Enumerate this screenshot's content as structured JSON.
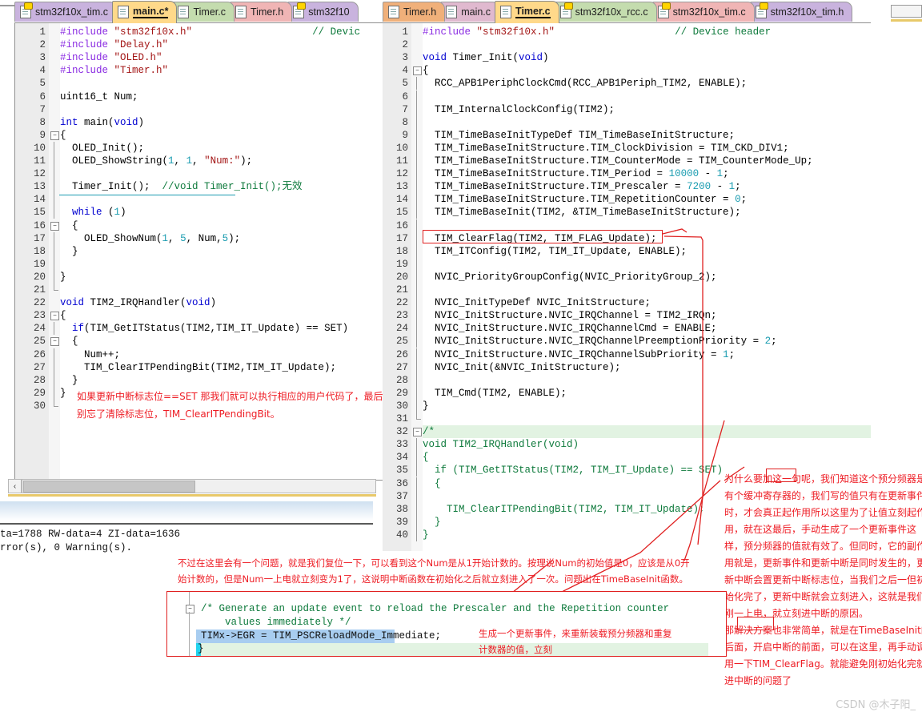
{
  "app": {
    "watermark": "CSDN @木子阳_"
  },
  "left_pane": {
    "tabs": [
      {
        "label": "stm32f10x_tim.c",
        "color": "#c9b3de",
        "active": false,
        "icon": "file-key-icon"
      },
      {
        "label": "main.c*",
        "color": "#ffd98a",
        "active": true,
        "icon": "file-icon"
      },
      {
        "label": "Timer.c",
        "color": "#c4dcae",
        "active": false,
        "icon": "file-icon"
      },
      {
        "label": "Timer.h",
        "color": "#f0b5b5",
        "active": false,
        "icon": "file-icon"
      },
      {
        "label": "stm32f10",
        "color": "#c9b3de",
        "active": false,
        "icon": "file-key-icon"
      }
    ],
    "lines": [
      {
        "n": 1,
        "fold": "",
        "tokens": [
          {
            "t": "#include ",
            "c": "pp"
          },
          {
            "t": "\"stm32f10x.h\"",
            "c": "str"
          },
          {
            "t": "                    ",
            "c": "pl"
          },
          {
            "t": "// Devic",
            "c": "cmt"
          }
        ]
      },
      {
        "n": 2,
        "fold": "",
        "tokens": [
          {
            "t": "#include ",
            "c": "pp"
          },
          {
            "t": "\"Delay.h\"",
            "c": "str"
          }
        ]
      },
      {
        "n": 3,
        "fold": "",
        "tokens": [
          {
            "t": "#include ",
            "c": "pp"
          },
          {
            "t": "\"OLED.h\"",
            "c": "str"
          }
        ]
      },
      {
        "n": 4,
        "fold": "",
        "tokens": [
          {
            "t": "#include ",
            "c": "pp"
          },
          {
            "t": "\"Timer.h\"",
            "c": "str"
          }
        ]
      },
      {
        "n": 5,
        "fold": "",
        "tokens": []
      },
      {
        "n": 6,
        "fold": "",
        "tokens": [
          {
            "t": "uint16_t Num;",
            "c": "pl"
          }
        ]
      },
      {
        "n": 7,
        "fold": "",
        "tokens": []
      },
      {
        "n": 8,
        "fold": "",
        "tokens": [
          {
            "t": "int",
            "c": "kw"
          },
          {
            "t": " main(",
            "c": "pl"
          },
          {
            "t": "void",
            "c": "kw"
          },
          {
            "t": ")",
            "c": "pl"
          }
        ]
      },
      {
        "n": 9,
        "fold": "-",
        "tokens": [
          {
            "t": "{",
            "c": "pl"
          }
        ]
      },
      {
        "n": 10,
        "fold": "|",
        "tokens": [
          {
            "t": "  OLED_Init();",
            "c": "pl"
          }
        ]
      },
      {
        "n": 11,
        "fold": "|",
        "tokens": [
          {
            "t": "  OLED_ShowString(",
            "c": "pl"
          },
          {
            "t": "1",
            "c": "num"
          },
          {
            "t": ", ",
            "c": "pl"
          },
          {
            "t": "1",
            "c": "num"
          },
          {
            "t": ", ",
            "c": "pl"
          },
          {
            "t": "\"Num:\"",
            "c": "str"
          },
          {
            "t": ");",
            "c": "pl"
          }
        ]
      },
      {
        "n": 12,
        "fold": "|",
        "tokens": []
      },
      {
        "n": 13,
        "fold": "|",
        "tokens": [
          {
            "t": "  Timer_Init();  ",
            "c": "pl"
          },
          {
            "t": "//void Timer_Init();无效",
            "c": "cmt"
          }
        ],
        "underline": true
      },
      {
        "n": 14,
        "fold": "|",
        "tokens": []
      },
      {
        "n": 15,
        "fold": "|",
        "tokens": [
          {
            "t": "  ",
            "c": "pl"
          },
          {
            "t": "while",
            "c": "kw"
          },
          {
            "t": " (",
            "c": "pl"
          },
          {
            "t": "1",
            "c": "num"
          },
          {
            "t": ")",
            "c": "pl"
          }
        ]
      },
      {
        "n": 16,
        "fold": "-",
        "tokens": [
          {
            "t": "  {",
            "c": "pl"
          }
        ]
      },
      {
        "n": 17,
        "fold": "|",
        "tokens": [
          {
            "t": "    OLED_ShowNum(",
            "c": "pl"
          },
          {
            "t": "1",
            "c": "num"
          },
          {
            "t": ", ",
            "c": "pl"
          },
          {
            "t": "5",
            "c": "num"
          },
          {
            "t": ", Num,",
            "c": "pl"
          },
          {
            "t": "5",
            "c": "num"
          },
          {
            "t": ");",
            "c": "pl"
          }
        ]
      },
      {
        "n": 18,
        "fold": "|",
        "tokens": [
          {
            "t": "  }",
            "c": "pl"
          }
        ]
      },
      {
        "n": 19,
        "fold": "|",
        "tokens": []
      },
      {
        "n": 20,
        "fold": "|",
        "tokens": [
          {
            "t": "}",
            "c": "pl"
          }
        ]
      },
      {
        "n": 21,
        "fold": "L",
        "tokens": []
      },
      {
        "n": 22,
        "fold": "",
        "tokens": [
          {
            "t": "void",
            "c": "kw"
          },
          {
            "t": " TIM2_IRQHandler(",
            "c": "pl"
          },
          {
            "t": "void",
            "c": "kw"
          },
          {
            "t": ")",
            "c": "pl"
          }
        ]
      },
      {
        "n": 23,
        "fold": "-",
        "tokens": [
          {
            "t": "{",
            "c": "pl"
          }
        ]
      },
      {
        "n": 24,
        "fold": "|",
        "tokens": [
          {
            "t": "  ",
            "c": "pl"
          },
          {
            "t": "if",
            "c": "kw"
          },
          {
            "t": "(TIM_GetITStatus(TIM2,TIM_IT_Update) == SET)",
            "c": "pl"
          }
        ]
      },
      {
        "n": 25,
        "fold": "-",
        "tokens": [
          {
            "t": "  {",
            "c": "pl"
          }
        ]
      },
      {
        "n": 26,
        "fold": "|",
        "tokens": [
          {
            "t": "    Num++;",
            "c": "pl"
          }
        ]
      },
      {
        "n": 27,
        "fold": "|",
        "tokens": [
          {
            "t": "    TIM_ClearITPendingBit(TIM2,TIM_IT_Update);",
            "c": "pl"
          }
        ]
      },
      {
        "n": 28,
        "fold": "|",
        "tokens": [
          {
            "t": "  }",
            "c": "pl"
          }
        ]
      },
      {
        "n": 29,
        "fold": "|",
        "tokens": [
          {
            "t": "}",
            "c": "pl"
          }
        ]
      },
      {
        "n": 30,
        "fold": "L",
        "tokens": []
      }
    ],
    "red_notes": [
      "如果更新中断标志位==SET 那我们就可以执行相应的用户代码了，最后",
      "别忘了清除标志位，TIM_ClearITPendingBit。"
    ],
    "hscroll_left_arrow": "‹"
  },
  "right_pane": {
    "tabs": [
      {
        "label": "Timer.h",
        "color": "#f0b07a",
        "active": false,
        "icon": "file-icon"
      },
      {
        "label": "main.c",
        "color": "#e0b9cf",
        "active": false,
        "icon": "file-icon"
      },
      {
        "label": "Timer.c",
        "color": "#ffd98a",
        "active": true,
        "icon": "file-icon"
      },
      {
        "label": "stm32f10x_rcc.c",
        "color": "#c4dcae",
        "active": false,
        "icon": "file-key-icon"
      },
      {
        "label": "stm32f10x_tim.c",
        "color": "#f0b5b5",
        "active": false,
        "icon": "file-key-icon"
      },
      {
        "label": "stm32f10x_tim.h",
        "color": "#c9b3de",
        "active": false,
        "icon": "file-key-icon"
      }
    ],
    "lines": [
      {
        "n": 1,
        "fold": "",
        "tokens": [
          {
            "t": "#include ",
            "c": "pp"
          },
          {
            "t": "\"stm32f10x.h\"",
            "c": "str"
          },
          {
            "t": "                    ",
            "c": "pl"
          },
          {
            "t": "// Device header",
            "c": "cmt"
          }
        ]
      },
      {
        "n": 2,
        "fold": "",
        "tokens": []
      },
      {
        "n": 3,
        "fold": "",
        "tokens": [
          {
            "t": "void",
            "c": "kw"
          },
          {
            "t": " Timer_Init(",
            "c": "pl"
          },
          {
            "t": "void",
            "c": "kw"
          },
          {
            "t": ")",
            "c": "pl"
          }
        ]
      },
      {
        "n": 4,
        "fold": "-",
        "tokens": [
          {
            "t": "{",
            "c": "pl"
          }
        ]
      },
      {
        "n": 5,
        "fold": "|",
        "tokens": [
          {
            "t": "  RCC_APB1PeriphClockCmd(RCC_APB1Periph_TIM2, ENABLE);",
            "c": "pl"
          }
        ]
      },
      {
        "n": 6,
        "fold": "|",
        "tokens": []
      },
      {
        "n": 7,
        "fold": "|",
        "tokens": [
          {
            "t": "  TIM_InternalClockConfig(TIM2);",
            "c": "pl"
          }
        ]
      },
      {
        "n": 8,
        "fold": "|",
        "tokens": []
      },
      {
        "n": 9,
        "fold": "|",
        "tokens": [
          {
            "t": "  TIM_TimeBaseInitTypeDef TIM_TimeBaseInitStructure;",
            "c": "pl"
          }
        ]
      },
      {
        "n": 10,
        "fold": "|",
        "tokens": [
          {
            "t": "  TIM_TimeBaseInitStructure.TIM_ClockDivision = TIM_CKD_DIV1;",
            "c": "pl"
          }
        ]
      },
      {
        "n": 11,
        "fold": "|",
        "tokens": [
          {
            "t": "  TIM_TimeBaseInitStructure.TIM_CounterMode = TIM_CounterMode_Up;",
            "c": "pl"
          }
        ]
      },
      {
        "n": 12,
        "fold": "|",
        "tokens": [
          {
            "t": "  TIM_TimeBaseInitStructure.TIM_Period = ",
            "c": "pl"
          },
          {
            "t": "10000",
            "c": "num"
          },
          {
            "t": " - ",
            "c": "pl"
          },
          {
            "t": "1",
            "c": "num"
          },
          {
            "t": ";",
            "c": "pl"
          }
        ]
      },
      {
        "n": 13,
        "fold": "|",
        "tokens": [
          {
            "t": "  TIM_TimeBaseInitStructure.TIM_Prescaler = ",
            "c": "pl"
          },
          {
            "t": "7200",
            "c": "num"
          },
          {
            "t": " - ",
            "c": "pl"
          },
          {
            "t": "1",
            "c": "num"
          },
          {
            "t": ";",
            "c": "pl"
          }
        ]
      },
      {
        "n": 14,
        "fold": "|",
        "tokens": [
          {
            "t": "  TIM_TimeBaseInitStructure.TIM_RepetitionCounter = ",
            "c": "pl"
          },
          {
            "t": "0",
            "c": "num"
          },
          {
            "t": ";",
            "c": "pl"
          }
        ]
      },
      {
        "n": 15,
        "fold": "|",
        "tokens": [
          {
            "t": "  TIM_TimeBaseInit(TIM2, &TIM_TimeBaseInitStructure);",
            "c": "pl"
          }
        ]
      },
      {
        "n": 16,
        "fold": "|",
        "tokens": []
      },
      {
        "n": 17,
        "fold": "|",
        "tokens": [
          {
            "t": "  TIM_ClearFlag(TIM2, TIM_FLAG_Update);",
            "c": "pl"
          }
        ]
      },
      {
        "n": 18,
        "fold": "|",
        "tokens": [
          {
            "t": "  TIM_ITConfig(TIM2, TIM_IT_Update, ENABLE);",
            "c": "pl"
          }
        ]
      },
      {
        "n": 19,
        "fold": "|",
        "tokens": []
      },
      {
        "n": 20,
        "fold": "|",
        "tokens": [
          {
            "t": "  NVIC_PriorityGroupConfig(NVIC_PriorityGroup_2);",
            "c": "pl"
          }
        ]
      },
      {
        "n": 21,
        "fold": "|",
        "tokens": []
      },
      {
        "n": 22,
        "fold": "|",
        "tokens": [
          {
            "t": "  NVIC_InitTypeDef NVIC_InitStructure;",
            "c": "pl"
          }
        ]
      },
      {
        "n": 23,
        "fold": "|",
        "tokens": [
          {
            "t": "  NVIC_InitStructure.NVIC_IRQChannel = TIM2_IRQn;",
            "c": "pl"
          }
        ]
      },
      {
        "n": 24,
        "fold": "|",
        "tokens": [
          {
            "t": "  NVIC_InitStructure.NVIC_IRQChannelCmd = ENABLE;",
            "c": "pl"
          }
        ]
      },
      {
        "n": 25,
        "fold": "|",
        "tokens": [
          {
            "t": "  NVIC_InitStructure.NVIC_IRQChannelPreemptionPriority = ",
            "c": "pl"
          },
          {
            "t": "2",
            "c": "num"
          },
          {
            "t": ";",
            "c": "pl"
          }
        ]
      },
      {
        "n": 26,
        "fold": "|",
        "tokens": [
          {
            "t": "  NVIC_InitStructure.NVIC_IRQChannelSubPriority = ",
            "c": "pl"
          },
          {
            "t": "1",
            "c": "num"
          },
          {
            "t": ";",
            "c": "pl"
          }
        ]
      },
      {
        "n": 27,
        "fold": "|",
        "tokens": [
          {
            "t": "  NVIC_Init(&NVIC_InitStructure);",
            "c": "pl"
          }
        ]
      },
      {
        "n": 28,
        "fold": "|",
        "tokens": []
      },
      {
        "n": 29,
        "fold": "|",
        "tokens": [
          {
            "t": "  TIM_Cmd(TIM2, ENABLE);",
            "c": "pl"
          }
        ]
      },
      {
        "n": 30,
        "fold": "|",
        "tokens": [
          {
            "t": "}",
            "c": "pl"
          }
        ]
      },
      {
        "n": 31,
        "fold": "L",
        "tokens": []
      },
      {
        "n": 32,
        "fold": "-",
        "tokens": [
          {
            "t": "/*",
            "c": "cmt"
          }
        ],
        "green": true
      },
      {
        "n": 33,
        "fold": "|",
        "tokens": [
          {
            "t": "void TIM2_IRQHandler(void)",
            "c": "cmt"
          }
        ]
      },
      {
        "n": 34,
        "fold": "|",
        "tokens": [
          {
            "t": "{",
            "c": "cmt"
          }
        ]
      },
      {
        "n": 35,
        "fold": "|",
        "tokens": [
          {
            "t": "  if (TIM_GetITStatus(TIM2, TIM_IT_Update) == SET)",
            "c": "cmt"
          }
        ]
      },
      {
        "n": 36,
        "fold": "|",
        "tokens": [
          {
            "t": "  {",
            "c": "cmt"
          }
        ]
      },
      {
        "n": 37,
        "fold": "|",
        "tokens": []
      },
      {
        "n": 38,
        "fold": "|",
        "tokens": [
          {
            "t": "    TIM_ClearITPendingBit(TIM2, TIM_IT_Update);",
            "c": "cmt"
          }
        ]
      },
      {
        "n": 39,
        "fold": "|",
        "tokens": [
          {
            "t": "  }",
            "c": "cmt"
          }
        ]
      },
      {
        "n": 40,
        "fold": "|",
        "tokens": [
          {
            "t": "}",
            "c": "cmt"
          }
        ]
      }
    ]
  },
  "build_output": {
    "line1": "ta=1788 RW-data=4 ZI-data=1636",
    "line2": "rror(s), 0 Warning(s)."
  },
  "annotations": {
    "right_paragraph": [
      "为什么要加这一句呢，我们知道这个预分频器是",
      "有个缓冲寄存器的，我们写的值只有在更新事件",
      "时，才会真正起作用所以这里为了让值立刻起作",
      "用，就在这最后，手动生成了一个更新事件这",
      "样，预分频器的值就有效了。但同时，它的副作",
      "用就是，更新事件和更新中断是同时发生的，更",
      "新中断会置更新中断标志位，当我们之后一但初",
      "始化完了，更新中断就会立刻进入，这就是我们",
      "刚一上电，就立刻进中断的原因。",
      "那解决方案也非常简单，就是在TimeBaseInit的",
      "后面，开启中断的前面，可以在这里，再手动调",
      "用一下TIM_ClearFlag。就能避免刚初始化完就",
      "进中断的问题了"
    ],
    "bottom_paragraph": [
      "不过在这里会有一个问题，就是我们复位一下，可以看到这个Num是从1开始计数的。按理说Num的初始值是0，应该是从0开",
      "始计数的，但是Num一上电就立刻变为1了，这说明中断函数在初始化之后就立刻进入了一次。问题出在TimeBaseInit函数。"
    ],
    "inline_notes": [
      "生成一个更新事件，来重新装载预分频器和重复",
      "计数器的值，立刻"
    ]
  },
  "bottom_snippet": {
    "lines": [
      "/* Generate an update event to reload the Prescaler and the Repetition counter",
      "    values immediately */",
      "TIMx->EGR = TIM_PSCReloadMode_Immediate;",
      "}"
    ]
  },
  "colors": {
    "red_ink": "#ee1c24",
    "comment_green": "#0e7a3c",
    "keyword_blue": "#0000d0",
    "string_red": "#a31515",
    "number_cyan": "#1a9cb0",
    "preproc_purple": "#8a2be2",
    "selection_blue": "#a8cdf0",
    "highlight_green": "#e2f3e2"
  }
}
